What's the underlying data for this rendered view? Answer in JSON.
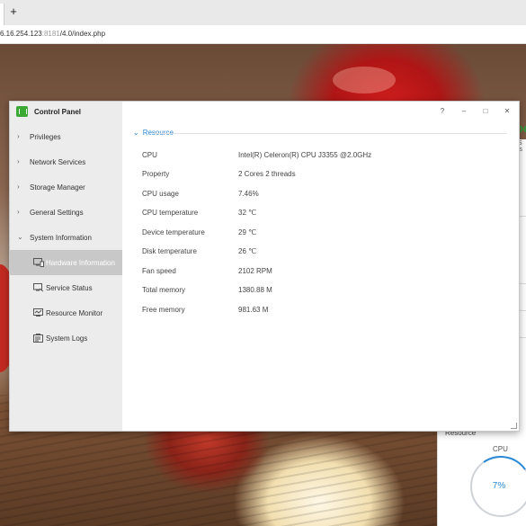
{
  "browser": {
    "new_tab_symbol": "+",
    "url_host": "6.16.254.123",
    "url_port": ":8181",
    "url_path": "/4.0/index.php"
  },
  "window": {
    "title": "Control Panel",
    "help_symbol": "?",
    "minimize_symbol": "–",
    "maximize_symbol": "□",
    "close_symbol": "✕"
  },
  "sidebar": {
    "items": [
      {
        "label": "Privileges",
        "icon": "chevron-right-icon"
      },
      {
        "label": "Network Services",
        "icon": "chevron-right-icon"
      },
      {
        "label": "Storage Manager",
        "icon": "chevron-right-icon"
      },
      {
        "label": "General Settings",
        "icon": "chevron-right-icon"
      },
      {
        "label": "System Information",
        "icon": "chevron-down-icon"
      }
    ],
    "sub_items": [
      {
        "label": "Hardware Information",
        "icon": "hardware-info-icon",
        "active": true
      },
      {
        "label": "Service Status",
        "icon": "service-status-icon",
        "active": false
      },
      {
        "label": "Resource Monitor",
        "icon": "resource-monitor-icon",
        "active": false
      },
      {
        "label": "System Logs",
        "icon": "system-logs-icon",
        "active": false
      }
    ]
  },
  "resource": {
    "heading": "Resource",
    "rows": [
      {
        "key": "CPU",
        "value": "Intel(R) Celeron(R) CPU J3355 @2.0GHz"
      },
      {
        "key": "Property",
        "value": "2 Cores 2 threads"
      },
      {
        "key": "CPU usage",
        "value": "7.46%"
      },
      {
        "key": "CPU temperature",
        "value": "32 ℃"
      },
      {
        "key": "Device temperature",
        "value": "29 ℃"
      },
      {
        "key": "Disk temperature",
        "value": "26 ℃"
      },
      {
        "key": "Fan speed",
        "value": "2102 RPM"
      },
      {
        "key": "Total memory",
        "value": "1380.88 M"
      },
      {
        "key": "Free memory",
        "value": "981.63 M"
      }
    ]
  },
  "dashboard": {
    "brand_fragment": "oc",
    "brand_sub": "S is",
    "resource_label": "Resource",
    "cpu_label": "CPU",
    "cpu_percent": "7%",
    "cpu_usage_fraction": 0.07,
    "accent_color": "#2a8ad8"
  },
  "colors": {
    "accent": "#2a86d6",
    "sidebar_bg": "#ececec",
    "active_bg": "#c8c8c8",
    "app_icon_green": "#3aaa35"
  }
}
